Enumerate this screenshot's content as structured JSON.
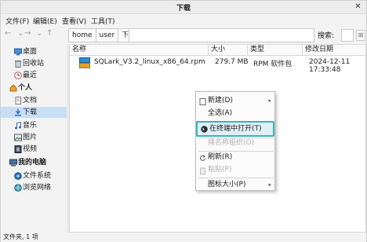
{
  "window": {
    "title": "下载",
    "close_glyph": "✕"
  },
  "menubar": {
    "file": "文件(F)",
    "edit": "编辑(E)",
    "view": "查看(V)",
    "tools": "工具(T)"
  },
  "toolbar": {
    "back_glyph": "←",
    "forward_glyph": "→",
    "dropdown_glyph": "⌄",
    "up_glyph": "↑",
    "crumbs": [
      "home",
      "user",
      "下载"
    ],
    "search_label": "搜索:",
    "view_glyph": "⊞"
  },
  "sidebar": {
    "items": [
      {
        "label": "桌面",
        "icon": "desktop-icon"
      },
      {
        "label": "回收站",
        "icon": "trash-icon"
      },
      {
        "label": "最近",
        "icon": "recent-icon"
      },
      {
        "label": "个人",
        "icon": "home-icon"
      },
      {
        "label": "文档",
        "icon": "document-icon"
      },
      {
        "label": "下载",
        "icon": "download-icon"
      },
      {
        "label": "音乐",
        "icon": "music-icon"
      },
      {
        "label": "图片",
        "icon": "picture-icon"
      },
      {
        "label": "视频",
        "icon": "video-icon"
      },
      {
        "label": "我的电脑",
        "icon": "computer-icon"
      },
      {
        "label": "文件系统",
        "icon": "filesystem-icon"
      },
      {
        "label": "浏览网络",
        "icon": "network-icon"
      }
    ]
  },
  "filelist": {
    "columns": [
      "名称",
      "大小",
      "类型",
      "修改日期"
    ],
    "rows": [
      {
        "name": "SQLark_V3.2_linux_x86_64.rpm",
        "size": "279.7 MB",
        "type": "RPM 软件包",
        "modified": "2024-12-11 17:33:48"
      }
    ]
  },
  "context_menu": {
    "new": "新建(D)",
    "select_all": "全选(A)",
    "open_terminal": "在终端中打开(T)",
    "sort_by": "排名称组织(O)",
    "refresh": "刷新(R)",
    "paste": "粘贴(P)",
    "icon_size": "图标大小(P)",
    "submenu_glyph": "▸"
  },
  "statusbar": {
    "text": "文件夹, 1 项"
  },
  "colors": {
    "accent_highlight": "#35b8b2",
    "selected_bg": "#c7def5"
  }
}
